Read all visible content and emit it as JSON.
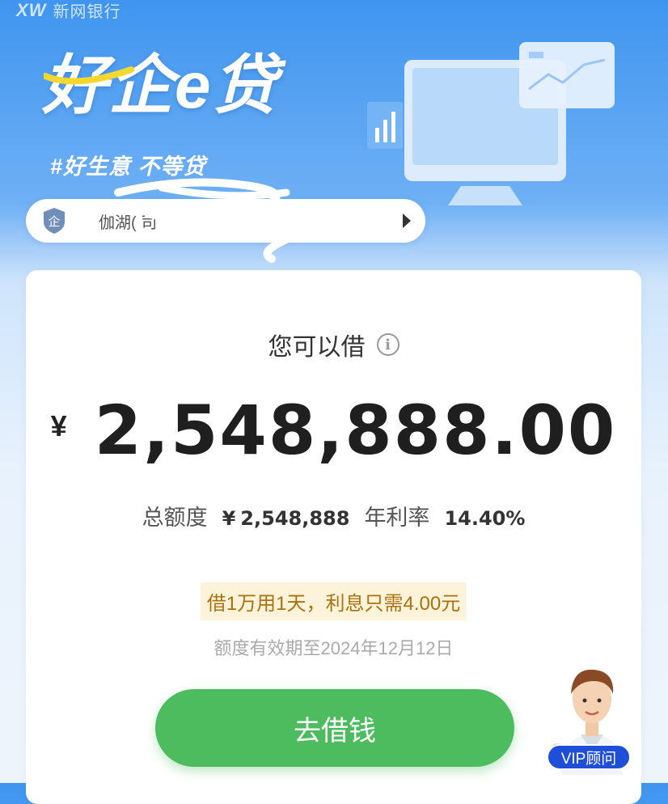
{
  "bank": {
    "logo_mark": "XW",
    "name": "新网银行"
  },
  "brand": {
    "title": "好企e贷",
    "slogan": "#好生意  不等贷"
  },
  "company_bar": {
    "badge_text": "企",
    "name": "伽湖(                                              司"
  },
  "loan": {
    "label": "您可以借",
    "currency": "¥",
    "amount": "2,548,888.00",
    "total_label": "总额度",
    "total_currency": "¥",
    "total_value": "2,548,888",
    "rate_label": "年利率",
    "rate_value": "14.40%",
    "promo": "借1万用1天，利息只需4.00元",
    "validity": "额度有效期至2024年12月12日"
  },
  "borrow_button": {
    "label": "去借钱"
  },
  "vip": {
    "label": "VIP顾问"
  },
  "colors": {
    "primary_green": "#4cbc5e",
    "brand_blue": "#3f95ef",
    "vip_blue": "#1f4fd8",
    "promo_text": "#a9720e"
  }
}
